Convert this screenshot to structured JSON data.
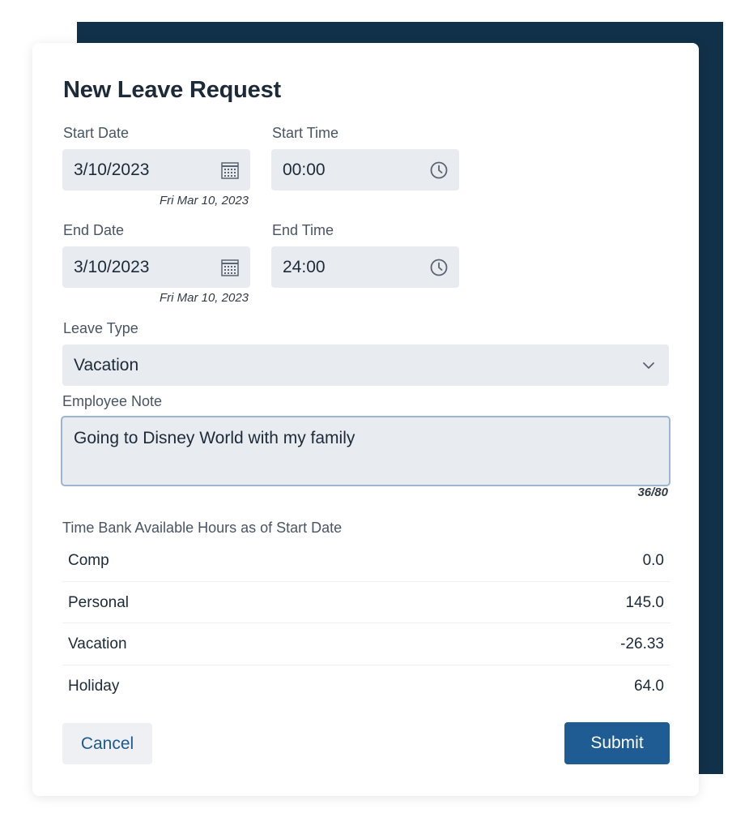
{
  "form": {
    "title": "New Leave Request",
    "start_date": {
      "label": "Start Date",
      "value": "3/10/2023",
      "hint": "Fri Mar 10, 2023"
    },
    "start_time": {
      "label": "Start Time",
      "value": "00:00"
    },
    "end_date": {
      "label": "End Date",
      "value": "3/10/2023",
      "hint": "Fri Mar 10, 2023"
    },
    "end_time": {
      "label": "End Time",
      "value": "24:00"
    },
    "leave_type": {
      "label": "Leave Type",
      "value": "Vacation"
    },
    "employee_note": {
      "label": "Employee Note",
      "value": "Going to Disney World with my family",
      "counter": "36/80"
    }
  },
  "time_bank": {
    "title": "Time Bank Available Hours as of Start Date",
    "rows": [
      {
        "name": "Comp",
        "hours": "0.0"
      },
      {
        "name": "Personal",
        "hours": "145.0"
      },
      {
        "name": "Vacation",
        "hours": "-26.33"
      },
      {
        "name": "Holiday",
        "hours": "64.0"
      }
    ]
  },
  "actions": {
    "cancel_label": "Cancel",
    "submit_label": "Submit"
  },
  "icons": {
    "date": "calendar-icon",
    "time": "clock-icon",
    "select": "chevron-down-icon"
  },
  "colors": {
    "backdrop": "#11314a",
    "field_bg": "#e8ebf0",
    "primary": "#1f5c94",
    "text": "#1d2a38"
  }
}
